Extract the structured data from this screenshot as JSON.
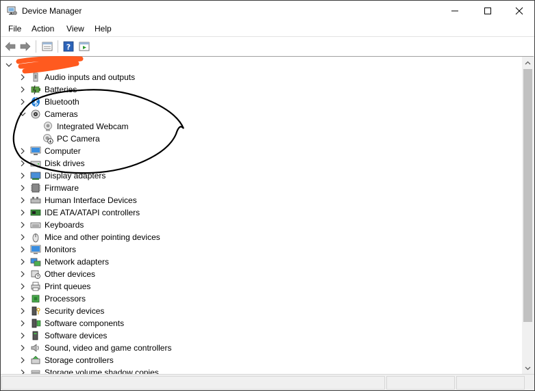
{
  "window": {
    "title": "Device Manager"
  },
  "menu": [
    "File",
    "Action",
    "View",
    "Help"
  ],
  "toolbar": {
    "buttons": [
      "back-icon",
      "forward-icon",
      "properties-icon",
      "help-icon",
      "run-icon"
    ]
  },
  "tree": {
    "root_label": "",
    "items": [
      {
        "label": "Audio inputs and outputs",
        "icon": "audio-icon",
        "expanded": false
      },
      {
        "label": "Batteries",
        "icon": "battery-icon",
        "expanded": false
      },
      {
        "label": "Bluetooth",
        "icon": "bluetooth-icon",
        "expanded": false
      },
      {
        "label": "Cameras",
        "icon": "camera-icon",
        "expanded": true
      },
      {
        "label": "Integrated Webcam",
        "icon": "webcam-icon",
        "child": true
      },
      {
        "label": "PC Camera",
        "icon": "webcam-disabled-icon",
        "child": true
      },
      {
        "label": "Computer",
        "icon": "computer-icon",
        "expanded": false
      },
      {
        "label": "Disk drives",
        "icon": "disk-icon",
        "expanded": false
      },
      {
        "label": "Display adapters",
        "icon": "display-icon",
        "expanded": false
      },
      {
        "label": "Firmware",
        "icon": "firmware-icon",
        "expanded": false
      },
      {
        "label": "Human Interface Devices",
        "icon": "hid-icon",
        "expanded": false
      },
      {
        "label": "IDE ATA/ATAPI controllers",
        "icon": "ide-icon",
        "expanded": false
      },
      {
        "label": "Keyboards",
        "icon": "keyboard-icon",
        "expanded": false
      },
      {
        "label": "Mice and other pointing devices",
        "icon": "mouse-icon",
        "expanded": false
      },
      {
        "label": "Monitors",
        "icon": "monitor-icon",
        "expanded": false
      },
      {
        "label": "Network adapters",
        "icon": "network-icon",
        "expanded": false
      },
      {
        "label": "Other devices",
        "icon": "other-devices-icon",
        "expanded": false
      },
      {
        "label": "Print queues",
        "icon": "printer-icon",
        "expanded": false
      },
      {
        "label": "Processors",
        "icon": "processor-icon",
        "expanded": false
      },
      {
        "label": "Security devices",
        "icon": "security-icon",
        "expanded": false
      },
      {
        "label": "Software components",
        "icon": "software-components-icon",
        "expanded": false
      },
      {
        "label": "Software devices",
        "icon": "software-devices-icon",
        "expanded": false
      },
      {
        "label": "Sound, video and game controllers",
        "icon": "sound-icon",
        "expanded": false
      },
      {
        "label": "Storage controllers",
        "icon": "storage-icon",
        "expanded": false
      },
      {
        "label": "Storage volume shadow copies",
        "icon": "shadow-copy-icon",
        "expanded": false
      }
    ]
  },
  "colors": {
    "redaction": "#ff5a1f",
    "annotation": "#000000",
    "accent": "#1e7bd4"
  }
}
